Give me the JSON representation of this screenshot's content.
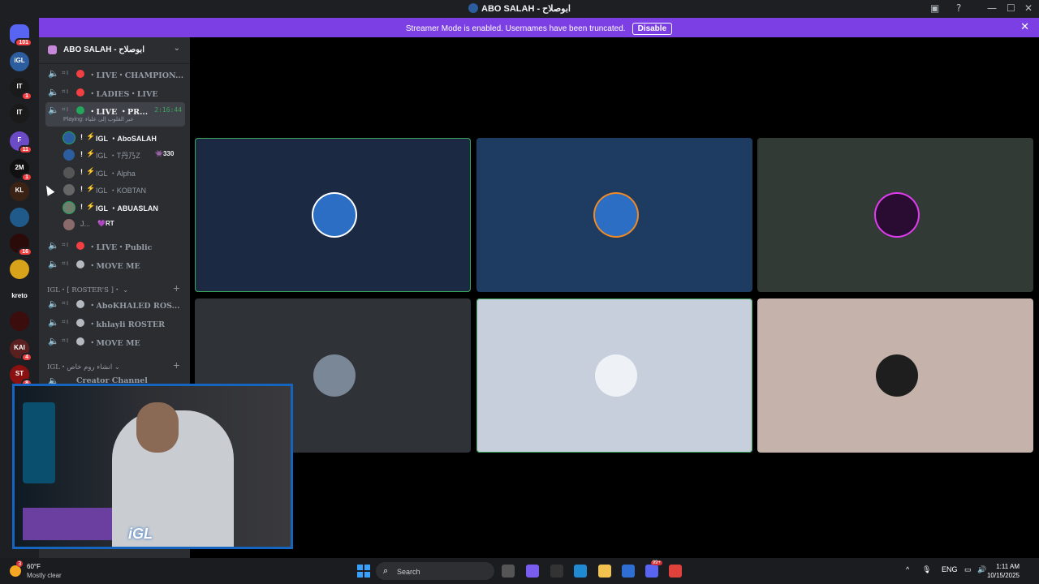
{
  "window": {
    "title": "ABO SALAH - ابوصلاح",
    "controls": {
      "inbox": "▣",
      "help": "?",
      "minimize": "—",
      "maximize": "☐",
      "close": "✕"
    }
  },
  "banner": {
    "message": "Streamer Mode is enabled. Usernames have been truncated.",
    "button": "Disable",
    "close": "✕"
  },
  "servers": [
    {
      "kind": "home",
      "badge": "101",
      "color": "#5865f2",
      "text": ""
    },
    {
      "kind": "server",
      "badge": "",
      "color": "#2c5d9e",
      "text": "iGL"
    },
    {
      "kind": "server",
      "badge": "1",
      "color": "#1a1a1a",
      "text": "IT"
    },
    {
      "kind": "server",
      "badge": "",
      "color": "#1a1a1a",
      "text": "IT"
    },
    {
      "kind": "server",
      "badge": "11",
      "color": "#6c4bc7",
      "text": "F"
    },
    {
      "kind": "server",
      "badge": "1",
      "color": "#111",
      "text": "2M"
    },
    {
      "kind": "server",
      "badge": "",
      "color": "#3a2214",
      "text": "KL"
    },
    {
      "kind": "server",
      "badge": "",
      "color": "#1f5a8a",
      "text": ""
    },
    {
      "kind": "server",
      "badge": "16",
      "color": "#2b0a0a",
      "text": ""
    },
    {
      "kind": "server",
      "badge": "",
      "color": "#d9a21b",
      "text": ""
    },
    {
      "kind": "server",
      "badge": "",
      "color": "#1e1f22",
      "text": "kreto"
    },
    {
      "kind": "server",
      "badge": "",
      "color": "#3b0d0d",
      "text": ""
    },
    {
      "kind": "server",
      "badge": "4",
      "color": "#5a2020",
      "text": "KAI"
    },
    {
      "kind": "server",
      "badge": "8",
      "color": "#8b1010",
      "text": "ST"
    }
  ],
  "sidebar": {
    "server_name": "ABO SALAH - ابوصلاح",
    "channels_top": [
      {
        "mark": "⌗॥",
        "dot": "#f23f42",
        "label": "・LIVE・CHAMPION..."
      },
      {
        "mark": "⌗॥",
        "dot": "#f23f42",
        "label": "・LADIES・LIVE"
      }
    ],
    "active_channel": {
      "mark": "⌗॥",
      "dot": "#23a55a",
      "label": "・LIVE ・PR...",
      "time": "2:16:44",
      "activity": "Playing: عبر القلوب إلى علياء"
    },
    "members": [
      {
        "name": "・AboSALAH",
        "prefix": "IGL",
        "speaking": true,
        "tag": "",
        "color": "#2c5d9e"
      },
      {
        "name": "・T丹乃Z",
        "prefix": "IGL",
        "speaking": false,
        "tag": "👾330",
        "color": "#2c5d9e"
      },
      {
        "name": "・Alpha",
        "prefix": "IGL",
        "speaking": false,
        "tag": "",
        "color": "#555"
      },
      {
        "name": "・KOBTAN",
        "prefix": "IGL",
        "speaking": false,
        "tag": "",
        "color": "#666"
      },
      {
        "name": "・ABUASLAN",
        "prefix": "IGL",
        "speaking": true,
        "tag": "",
        "color": "#6e7f6e"
      },
      {
        "name": "J...",
        "prefix": "",
        "speaking": false,
        "tag": "💜RT",
        "color": "#8a6a6a"
      }
    ],
    "channels_mid": [
      {
        "mark": "⌗॥",
        "dot": "#f23f42",
        "label": "・LIVE・Public"
      },
      {
        "mark": "⌗॥",
        "dot": "#b5bac1",
        "label": "・MOVE ME"
      }
    ],
    "category_rosters": {
      "label": "IGL・[ ROSTER'S ]・ ⌄",
      "add": "+"
    },
    "channels_rosters": [
      {
        "mark": "⌗॥",
        "dot": "#b5bac1",
        "label": "・AboKHALED ROS..."
      },
      {
        "mark": "⌗॥",
        "dot": "#b5bac1",
        "label": "・khlayli ROSTER"
      },
      {
        "mark": "⌗॥",
        "dot": "#b5bac1",
        "label": "・MOVE ME"
      }
    ],
    "category_private": {
      "label": "IGL・انشاء روم خاص ⌄",
      "add": "+"
    },
    "create_channel": "Creator Channel"
  },
  "video_tiles": [
    {
      "bg": "#1b2a42",
      "speaking": true,
      "avatar": "#2b6ec4",
      "ring": "#ffffff"
    },
    {
      "bg": "#1e3b61",
      "speaking": false,
      "avatar": "#2b6ec4",
      "ring": "#f08a24"
    },
    {
      "bg": "#323a36",
      "speaking": false,
      "avatar": "#2a0c33",
      "ring": "#e13cf0"
    },
    {
      "bg": "#2f3236",
      "speaking": false,
      "avatar": "#7a8796",
      "ring": "#2f3236"
    },
    {
      "bg": "#c7cfdc",
      "speaking": true,
      "avatar": "#eef2f7",
      "ring": "#c7cfdc"
    },
    {
      "bg": "#c4b2ab",
      "speaking": false,
      "avatar": "#1e1e1e",
      "ring": "#c4b2ab"
    }
  ],
  "webcam": {
    "logo": "iGL"
  },
  "taskbar": {
    "weather": {
      "badge": "3",
      "temp": "60°F",
      "condition": "Mostly clear"
    },
    "search_placeholder": "Search",
    "apps": [
      {
        "name": "task-view",
        "color": "#555",
        "badge": ""
      },
      {
        "name": "copilot",
        "color": "#7b5cf0",
        "badge": ""
      },
      {
        "name": "app-dark",
        "color": "#333",
        "badge": ""
      },
      {
        "name": "edge",
        "color": "#1f8ad2",
        "badge": ""
      },
      {
        "name": "file-explorer",
        "color": "#f2c14e",
        "badge": ""
      },
      {
        "name": "store",
        "color": "#2f6fd4",
        "badge": ""
      },
      {
        "name": "discord",
        "color": "#5865f2",
        "badge": "99+"
      },
      {
        "name": "chrome",
        "color": "#e0413a",
        "badge": ""
      }
    ],
    "tray": {
      "chevron": "^",
      "mic": "🎙",
      "lang": "ENG",
      "net": "▭",
      "vol": "🔊"
    },
    "clock": {
      "time": "1:11 AM",
      "date": "10/15/2025"
    }
  }
}
